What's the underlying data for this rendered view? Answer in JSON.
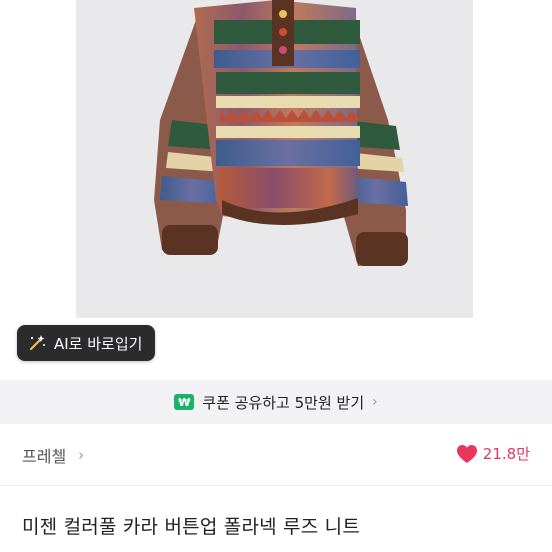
{
  "ai_button": {
    "label": "AI로 바로입기",
    "icon": "magic-wand-icon"
  },
  "coupon": {
    "badge": "₩",
    "text": "쿠폰 공유하고 5만원 받기",
    "chevron": "›"
  },
  "shop": {
    "name": "프레첼",
    "chevron": "›"
  },
  "likes": {
    "count": "21.8만",
    "icon": "heart-icon",
    "color": "#e9365d"
  },
  "product": {
    "title": "미젠 컬러풀 카라 버튼업 폴라넥 루즈 니트",
    "image": "product-photo-knit-sweater"
  },
  "colors": {
    "coupon_badge": "#1bb169",
    "ai_button_bg": "#2b2b2d",
    "coupon_bar_bg": "#f2f2f4"
  }
}
